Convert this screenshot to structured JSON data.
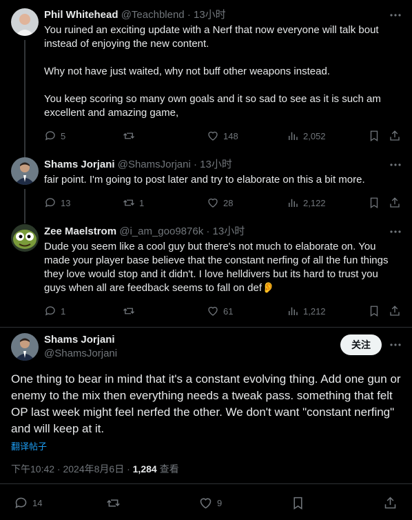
{
  "tweets": [
    {
      "name": "Phil Whitehead",
      "handle": "@Teachblend",
      "time": "· 13小时",
      "paragraphs": [
        "You ruined an exciting update with a Nerf that now everyone will talk bout instead of enjoying the new content.",
        "Why not have just waited, why not buff other weapons instead.",
        "You keep scoring so many own goals and it so sad to see as it is such am excellent and amazing game,"
      ],
      "replies": "5",
      "reposts": "",
      "likes": "148",
      "views": "2,052"
    },
    {
      "name": "Shams Jorjani",
      "handle": "@ShamsJorjani",
      "time": "· 13小时",
      "paragraphs": [
        "fair point. I'm going to post later and try to elaborate on this a bit more."
      ],
      "replies": "13",
      "reposts": "1",
      "likes": "28",
      "views": "2,122"
    },
    {
      "name": "Zee Maelstrom",
      "handle": "@i_am_goo9876k",
      "time": "· 13小时",
      "paragraphs": [
        "Dude you seem like a cool guy but there's not much to elaborate on. You made your player base believe that the constant nerfing of all the fun things they love would stop and it didn't. I love helldivers  but its hard to trust you guys when all are feedback seems to fall on def👂"
      ],
      "replies": "1",
      "reposts": "",
      "likes": "61",
      "views": "1,212"
    }
  ],
  "main": {
    "name": "Shams Jorjani",
    "handle": "@ShamsJorjani",
    "follow_label": "关注",
    "text": "One thing to bear in mind that it's a constant evolving thing. Add one gun or enemy to the mix then everything needs a tweak pass. something that felt OP last week might feel nerfed the other. We don't want \"constant nerfing\" and will keep at it.",
    "translate_label": "翻译帖子",
    "timestamp": "下午10:42 · 2024年8月6日 · ",
    "view_count": "1,284",
    "view_label": " 查看",
    "replies": "14",
    "reposts": "",
    "likes": "9"
  },
  "icons": [
    "reply-icon",
    "repost-icon",
    "like-icon",
    "views-icon",
    "bookmark-icon",
    "share-icon",
    "more-icon"
  ],
  "colors": {
    "background": "#000000",
    "text": "#e7e9ea",
    "muted": "#71767b",
    "link": "#1d9bf0",
    "divider": "#2f3336"
  }
}
